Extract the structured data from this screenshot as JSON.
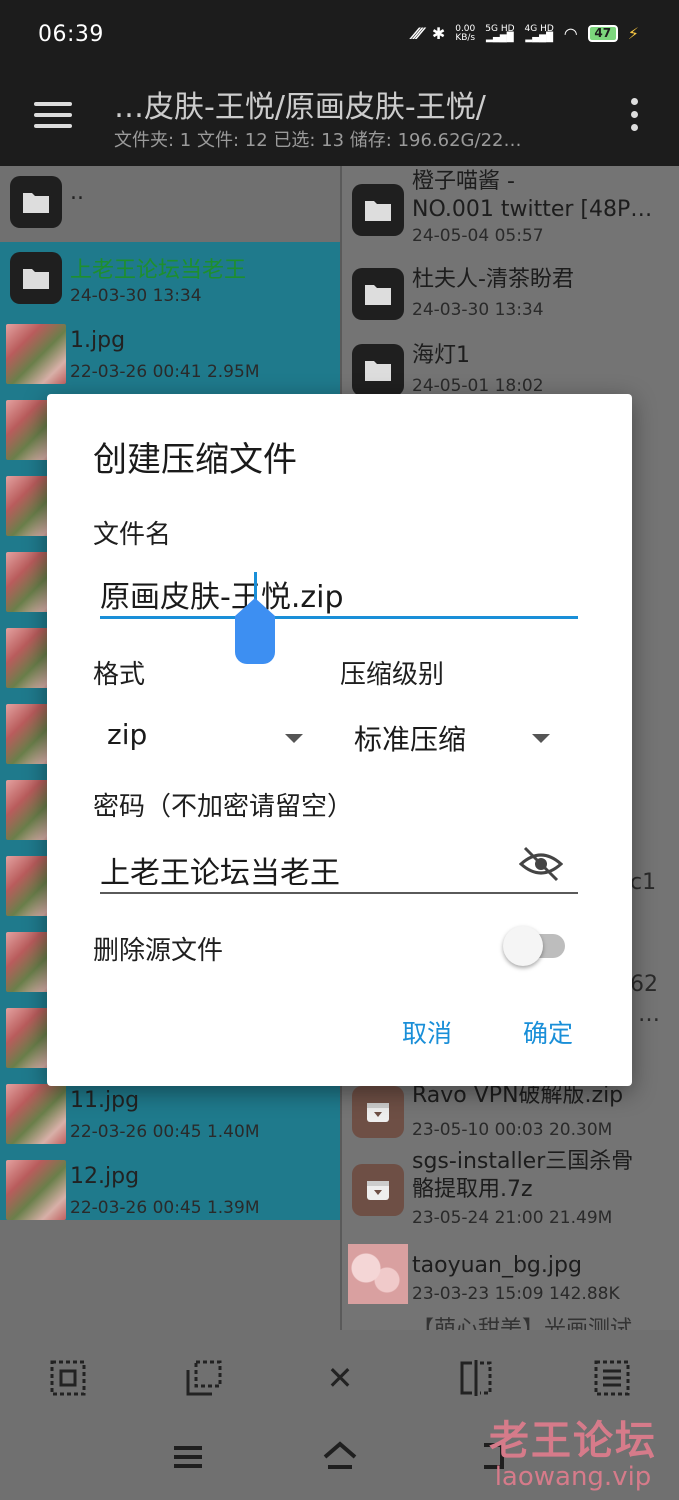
{
  "status_bar": {
    "time": "06:39",
    "net_speed_value": "0.00",
    "net_speed_unit": "KB/s",
    "sim1": "5G HD",
    "sim2": "4G HD",
    "battery": "47"
  },
  "app_bar": {
    "path_title": "…皮肤-王悦/原画皮肤-王悦/",
    "summary": "文件夹: 1  文件: 12  已选: 13  储存: 196.62G/22…"
  },
  "left_pane": {
    "parent_label": "..",
    "items": [
      {
        "name": "上老王论坛当老王",
        "meta": "24-03-30 13:34",
        "type": "folder"
      },
      {
        "name": "1.jpg",
        "meta": "22-03-26 00:41  2.95M",
        "type": "image"
      },
      {
        "name": "11.jpg",
        "meta": "22-03-26 00:45  1.40M",
        "type": "image"
      },
      {
        "name": "12.jpg",
        "meta": "22-03-26 00:45  1.39M",
        "type": "image"
      }
    ]
  },
  "right_pane": {
    "items": [
      {
        "name_line1": "橙子喵酱 -",
        "name_line2": "NO.001 twitter [48P…",
        "meta": "24-05-04 05:57",
        "type": "folder"
      },
      {
        "name_line1": "杜夫人-清茶盼君",
        "meta": "24-03-30 13:34",
        "type": "folder"
      },
      {
        "name_line1": "海灯1",
        "meta": "24-05-01 18:02",
        "type": "folder"
      },
      {
        "partial": "c1"
      },
      {
        "partial": "62"
      },
      {
        "partial": "…"
      },
      {
        "name_line1": "Ravo VPN破解版.zip",
        "meta": "23-05-10 00:03  20.30M",
        "type": "archive"
      },
      {
        "name_line1": "sgs-installer三国杀骨",
        "name_line2": "骼提取用.7z",
        "meta": "23-05-24 21:00  21.49M",
        "type": "archive"
      },
      {
        "name_line1": "taoyuan_bg.jpg",
        "meta": "23-03-23 15:09  142.88K",
        "type": "image"
      },
      {
        "name_line1": "【萌心甜美】光画测试"
      }
    ]
  },
  "dialog": {
    "title": "创建压缩文件",
    "filename_label": "文件名",
    "filename_before_cursor": "原画皮肤-",
    "filename_after_cursor": "王悦.zip",
    "format_label": "格式",
    "format_value": "zip",
    "level_label": "压缩级别",
    "level_value": "标准压缩",
    "password_label": "密码（不加密请留空）",
    "password_value": "上老王论坛当老王",
    "delete_source_label": "删除源文件",
    "delete_source_enabled": false,
    "cancel_label": "取消",
    "ok_label": "确定"
  },
  "watermark": {
    "line1": "老王论坛",
    "line2": "laowang.vip"
  },
  "colors": {
    "accent": "#1a8fd8",
    "selection": "#1f7a8c",
    "green_text": "#1e8f2e"
  }
}
